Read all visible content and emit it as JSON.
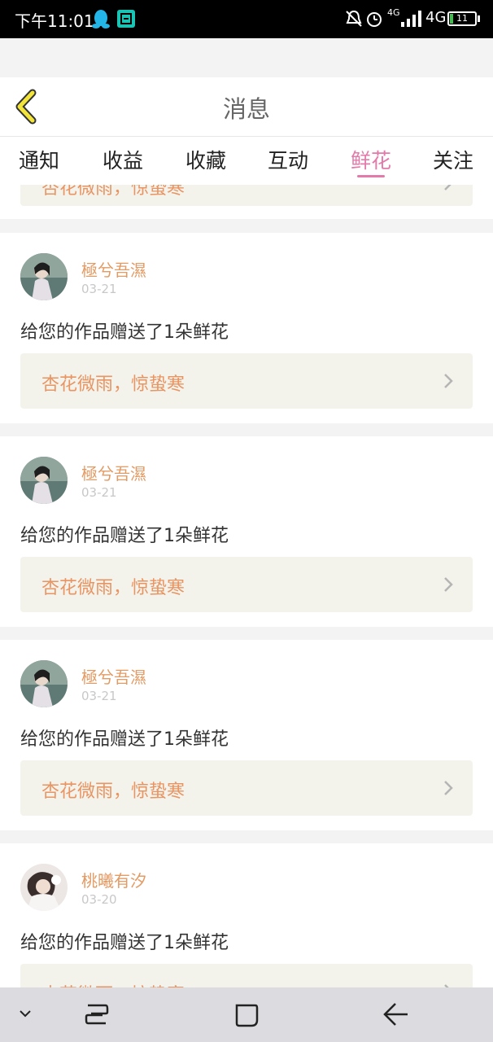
{
  "status_bar": {
    "time": "下午11:01",
    "network_4g_small": "4G",
    "network_4g": "4G",
    "battery": "11"
  },
  "header": {
    "title": "消息"
  },
  "tabs": [
    {
      "label": "通知",
      "active": false
    },
    {
      "label": "收益",
      "active": false
    },
    {
      "label": "收藏",
      "active": false
    },
    {
      "label": "互动",
      "active": false
    },
    {
      "label": "鲜花",
      "active": true
    },
    {
      "label": "关注",
      "active": false
    }
  ],
  "accent_colors": {
    "tab_active": "#e37aa9",
    "username": "#e39a63",
    "work_title": "#e89563"
  },
  "messages": [
    {
      "user": "極兮吾濕",
      "date": "03-21",
      "text": "给您的作品赠送了1朵鲜花",
      "work": "杏花微雨，惊蛰寒"
    },
    {
      "user": "極兮吾濕",
      "date": "03-21",
      "text": "给您的作品赠送了1朵鲜花",
      "work": "杏花微雨，惊蛰寒"
    },
    {
      "user": "極兮吾濕",
      "date": "03-21",
      "text": "给您的作品赠送了1朵鲜花",
      "work": "杏花微雨，惊蛰寒"
    },
    {
      "user": "桃曦有汐",
      "date": "03-20",
      "text": "给您的作品赠送了1朵鲜花",
      "work": "杏花微雨，惊蛰寒"
    }
  ],
  "partial_top_work": "杏花微雨，惊蛰寒",
  "icons": {
    "back": "chevron-left-icon",
    "nav_hide": "chevron-down-icon",
    "nav_recents": "recents-icon",
    "nav_home": "home-icon",
    "nav_back": "back-arrow-icon"
  }
}
